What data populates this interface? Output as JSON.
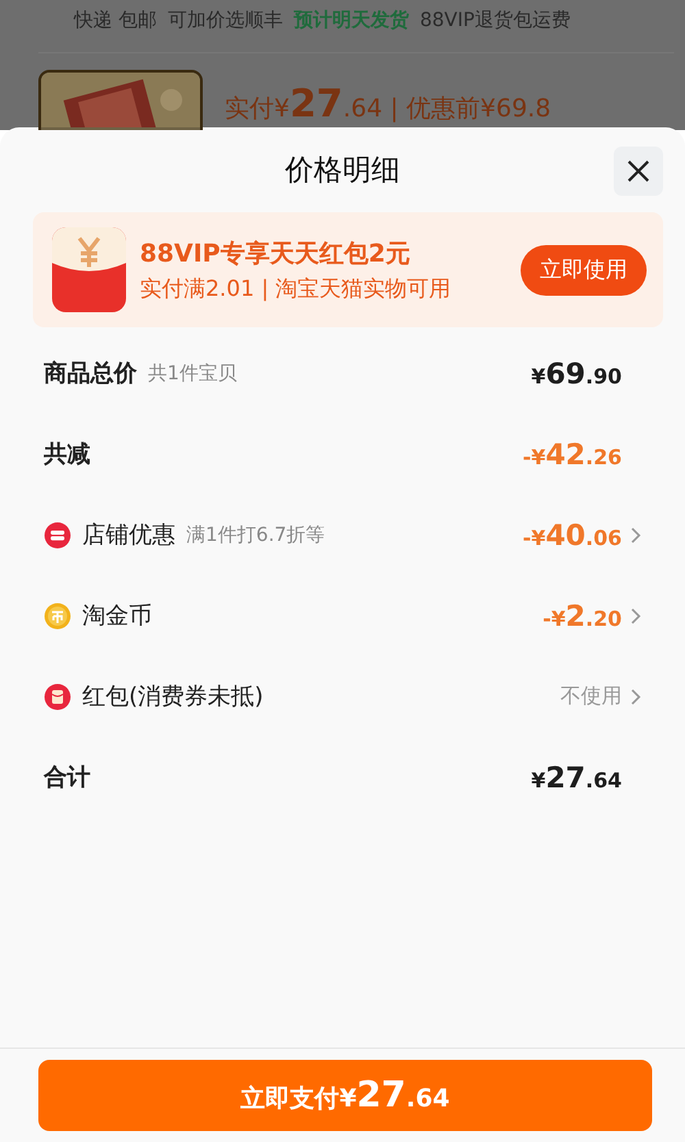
{
  "background": {
    "shipping_tags": [
      {
        "text": "快递 包邮",
        "kind": "plain"
      },
      {
        "text": "可加价选顺丰",
        "kind": "plain"
      },
      {
        "text": "预计明天发货",
        "kind": "highlight"
      },
      {
        "text": "88VIP退货包运费",
        "kind": "plain"
      }
    ],
    "product": {
      "price_line": "实付¥**27**.64 | 优惠前¥69.8"
    }
  },
  "sheet": {
    "title": "价格明细",
    "coupon": {
      "title": "88VIP专享天天红包2元",
      "subtitle": "实付满2.01 | 淘宝天猫实物可用",
      "button": "立即使用"
    },
    "rows": [
      {
        "kind": "heading",
        "label": "商品总价",
        "note": "共1件宝贝",
        "value": {
          "kind": "plain",
          "text": "¥**69**.90"
        },
        "chevron": false
      },
      {
        "kind": "heading",
        "label": "共减",
        "value": {
          "kind": "discount",
          "text": "-¥**42**.26"
        },
        "chevron": false
      },
      {
        "kind": "item",
        "label": "店铺优惠",
        "note": "满1件打6.7折等",
        "value": {
          "kind": "discount",
          "text": "-¥**40**.06"
        },
        "chevron": true
      },
      {
        "kind": "item",
        "label": "淘金币",
        "value": {
          "kind": "discount",
          "text": "-¥**2**.20"
        },
        "chevron": true
      },
      {
        "kind": "item",
        "label": "红包(消费券未抵)",
        "value": {
          "kind": "muted",
          "text": "不使用"
        },
        "chevron": true
      },
      {
        "kind": "heading",
        "label": "合计",
        "value": {
          "kind": "plain",
          "text": "¥**27**.64"
        },
        "chevron": false
      }
    ],
    "pay_button": "立即支付¥**27**.64"
  }
}
